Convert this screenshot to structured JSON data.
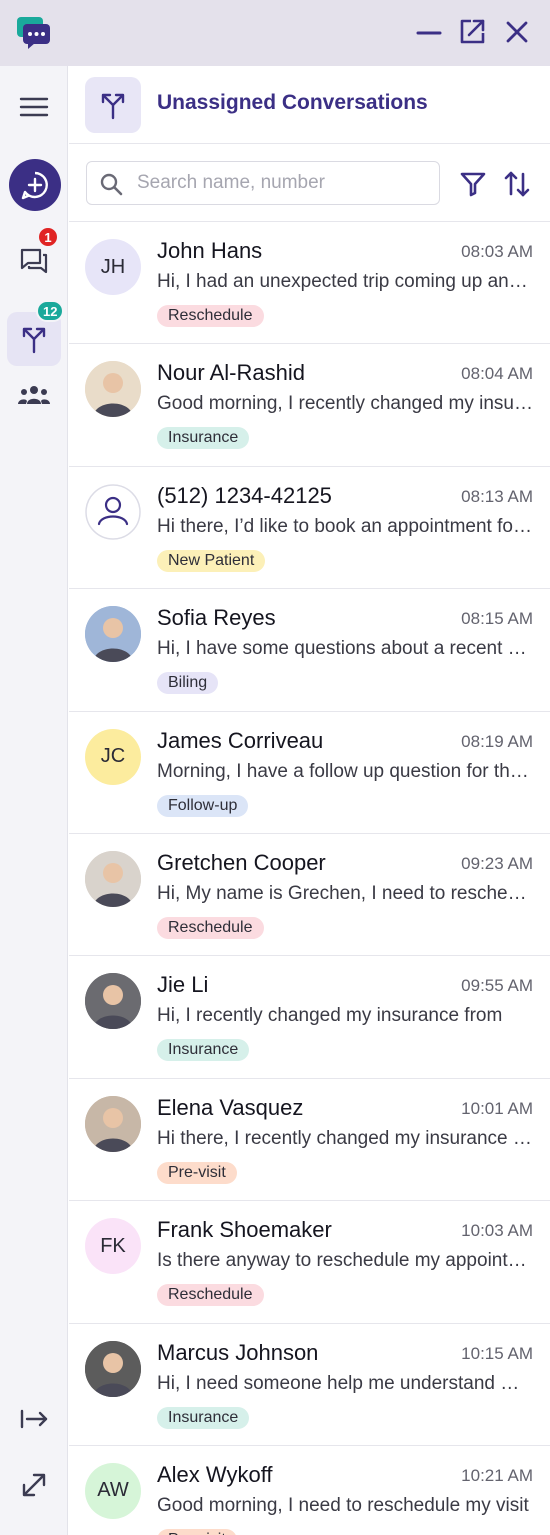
{
  "header": {
    "title": "Unassigned Conversations"
  },
  "search": {
    "placeholder": "Search name, number"
  },
  "sidebar": {
    "messages_badge": "1",
    "unassigned_badge": "12"
  },
  "tag_colors": {
    "Reschedule": "#fbdbe0",
    "Insurance": "#d6f0ea",
    "New Patient": "#fcf0b8",
    "Biling": "#e6e4f7",
    "Follow-up": "#dbe5f7",
    "Pre-visit": "#fddccb"
  },
  "conversations": [
    {
      "name": "John Hans",
      "time": "08:03 AM",
      "preview": "Hi, I had an unexpected trip coming up and need to reschedule",
      "tag": "Reschedule",
      "initials": "JH",
      "avatar_type": "initials",
      "avatar_bg": "#e7e5f8"
    },
    {
      "name": "Nour Al-Rashid",
      "time": "08:04 AM",
      "preview": "Good morning, I recently changed my insurance provider",
      "tag": "Insurance",
      "initials": "",
      "avatar_type": "photo",
      "avatar_bg": "#e9dcc9"
    },
    {
      "name": "(512) 1234-42125",
      "time": "08:13 AM",
      "preview": "Hi there, I’d like to book an appointment for next week",
      "tag": "New Patient",
      "initials": "",
      "avatar_type": "unknown",
      "avatar_bg": "#ffffff"
    },
    {
      "name": "Sofia Reyes",
      "time": "08:15 AM",
      "preview": "Hi, I have some questions about a recent bill I received",
      "tag": "Biling",
      "initials": "",
      "avatar_type": "photo",
      "avatar_bg": "#9fb6d8"
    },
    {
      "name": "James Corriveau",
      "time": "08:19 AM",
      "preview": "Morning, I have a follow up question for the doctor",
      "tag": "Follow-up",
      "initials": "JC",
      "avatar_type": "initials",
      "avatar_bg": "#fcec9e"
    },
    {
      "name": "Gretchen Cooper",
      "time": "09:23 AM",
      "preview": "Hi, My name is Grechen, I need to reschedule my visit",
      "tag": "Reschedule",
      "initials": "",
      "avatar_type": "photo",
      "avatar_bg": "#d9d3cc"
    },
    {
      "name": "Jie Li",
      "time": "09:55 AM",
      "preview": "Hi, I recently changed my insurance from",
      "tag": "Insurance",
      "initials": "",
      "avatar_type": "photo",
      "avatar_bg": "#6b6b70"
    },
    {
      "name": "Elena Vasquez",
      "time": "10:01 AM",
      "preview": "Hi there, I recently changed my insurance provider",
      "tag": "Pre-visit",
      "initials": "",
      "avatar_type": "photo",
      "avatar_bg": "#c7b7a7"
    },
    {
      "name": "Frank Shoemaker",
      "time": "10:03 AM",
      "preview": "Is there anyway to reschedule my appointment",
      "tag": "Reschedule",
      "initials": "FK",
      "avatar_type": "initials",
      "avatar_bg": "#fae3f8"
    },
    {
      "name": "Marcus Johnson",
      "time": "10:15 AM",
      "preview": "Hi, I need someone help me understand my bill",
      "tag": "Insurance",
      "initials": "",
      "avatar_type": "photo",
      "avatar_bg": "#5c5c5c"
    },
    {
      "name": "Alex Wykoff",
      "time": "10:21 AM",
      "preview": "Good morning, I need to reschedule my visit",
      "tag": "Pre-visit",
      "initials": "AW",
      "avatar_type": "initials",
      "avatar_bg": "#d6f5d8"
    }
  ]
}
